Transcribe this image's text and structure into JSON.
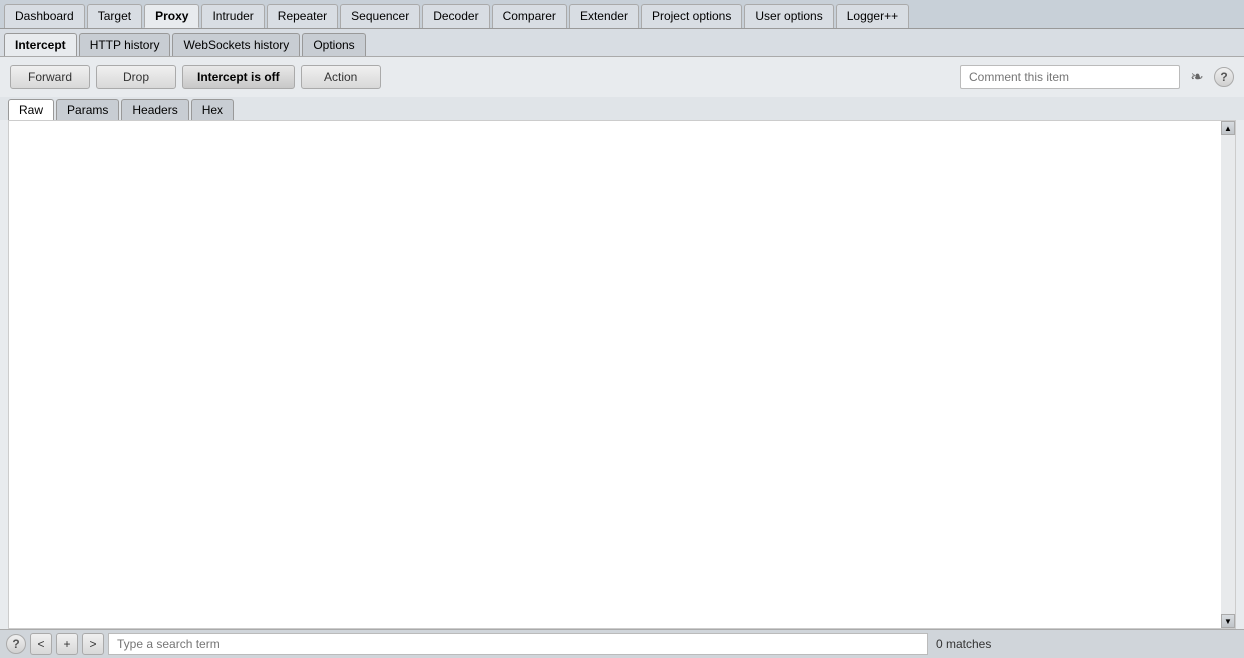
{
  "topNav": {
    "tabs": [
      {
        "label": "Dashboard",
        "active": false
      },
      {
        "label": "Target",
        "active": false
      },
      {
        "label": "Proxy",
        "active": true
      },
      {
        "label": "Intruder",
        "active": false
      },
      {
        "label": "Repeater",
        "active": false
      },
      {
        "label": "Sequencer",
        "active": false
      },
      {
        "label": "Decoder",
        "active": false
      },
      {
        "label": "Comparer",
        "active": false
      },
      {
        "label": "Extender",
        "active": false
      },
      {
        "label": "Project options",
        "active": false
      },
      {
        "label": "User options",
        "active": false
      },
      {
        "label": "Logger++",
        "active": false
      }
    ]
  },
  "subNav": {
    "tabs": [
      {
        "label": "Intercept",
        "active": true
      },
      {
        "label": "HTTP history",
        "active": false
      },
      {
        "label": "WebSockets history",
        "active": false
      },
      {
        "label": "Options",
        "active": false
      }
    ]
  },
  "toolbar": {
    "forward_label": "Forward",
    "drop_label": "Drop",
    "intercept_label": "Intercept is off",
    "action_label": "Action",
    "comment_placeholder": "Comment this item"
  },
  "innerTabs": {
    "tabs": [
      {
        "label": "Raw",
        "active": true
      },
      {
        "label": "Params",
        "active": false
      },
      {
        "label": "Headers",
        "active": false
      },
      {
        "label": "Hex",
        "active": false
      }
    ]
  },
  "bottomBar": {
    "prev_label": "<",
    "add_label": "+",
    "next_label": ">",
    "search_placeholder": "Type a search term",
    "matches_label": "0 matches"
  },
  "icons": {
    "help": "?",
    "send": "❧",
    "scroll_up": "▲",
    "scroll_down": "▼"
  }
}
